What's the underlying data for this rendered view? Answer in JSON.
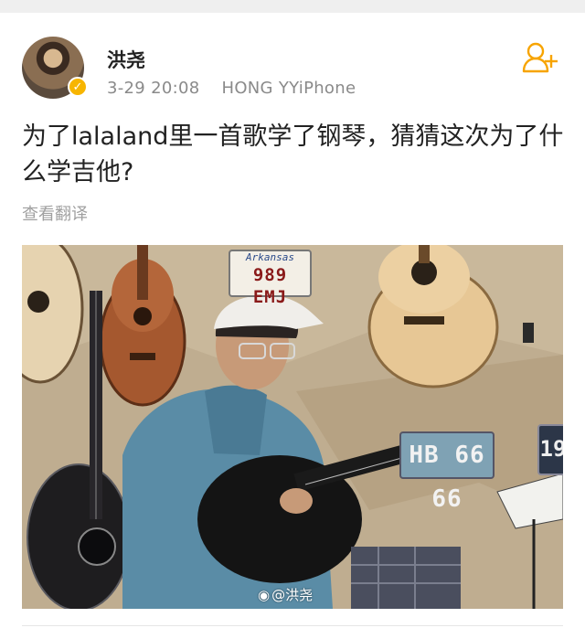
{
  "post": {
    "username": "洪尧",
    "time": "3-29 20:08",
    "source": "HONG YYiPhone",
    "text": "为了lalaland里一首歌学了钢琴，猜猜这次为了什么学吉他?",
    "translate_label": "查看翻译",
    "verified_mark": "✓"
  },
  "photo": {
    "plate_left_state": "Arkansas",
    "plate_left_number": "989 EMJ",
    "plate_right_number": "HB 66 66",
    "plate_edge_number": "19",
    "watermark": "@洪尧"
  },
  "icons": {
    "follow": "follow-user-icon",
    "verified": "verified-badge-icon",
    "weibo": "weibo-logo-icon"
  },
  "colors": {
    "accent": "#f7a400",
    "verified": "#f7b500",
    "text": "#222222",
    "meta": "#8a8a8a"
  }
}
